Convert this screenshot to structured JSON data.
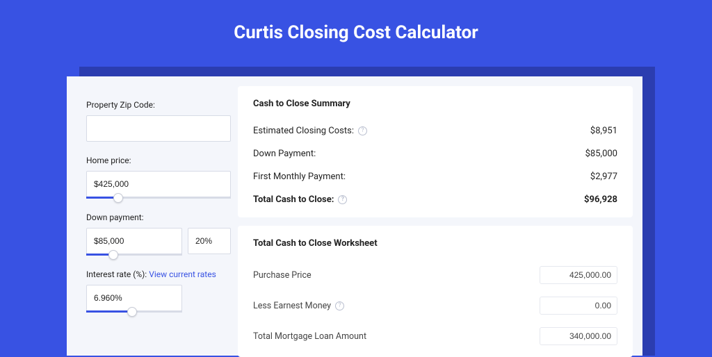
{
  "header": {
    "title": "Curtis Closing Cost Calculator"
  },
  "form": {
    "zip": {
      "label": "Property Zip Code:",
      "value": ""
    },
    "home_price": {
      "label": "Home price:",
      "value": "$425,000",
      "slider_pct": 22
    },
    "down_payment": {
      "label": "Down payment:",
      "value": "$85,000",
      "pct": "20%",
      "slider_pct": 28
    },
    "interest": {
      "label": "Interest rate (%):",
      "link": "View current rates",
      "value": "6.960%",
      "slider_pct": 48
    }
  },
  "summary": {
    "title": "Cash to Close Summary",
    "rows": [
      {
        "label": "Estimated Closing Costs:",
        "help": true,
        "value": "$8,951"
      },
      {
        "label": "Down Payment:",
        "help": false,
        "value": "$85,000"
      },
      {
        "label": "First Monthly Payment:",
        "help": false,
        "value": "$2,977"
      }
    ],
    "total": {
      "label": "Total Cash to Close:",
      "help": true,
      "value": "$96,928"
    }
  },
  "worksheet": {
    "title": "Total Cash to Close Worksheet",
    "rows": [
      {
        "label": "Purchase Price",
        "help": false,
        "value": "425,000.00"
      },
      {
        "label": "Less Earnest Money",
        "help": true,
        "value": "0.00"
      },
      {
        "label": "Total Mortgage Loan Amount",
        "help": false,
        "value": "340,000.00"
      }
    ]
  },
  "icons": {
    "help_glyph": "?"
  }
}
